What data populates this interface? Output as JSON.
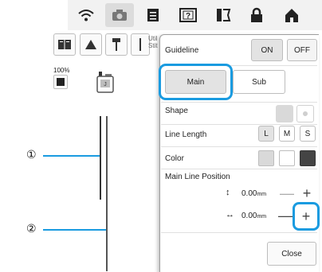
{
  "toolbar": {
    "icons": [
      "wifi-icon",
      "camera-icon",
      "document-icon",
      "help-icon",
      "thread-icon",
      "lock-icon",
      "home-icon"
    ]
  },
  "tools": {
    "util_label_1": "Util",
    "util_label_2": "Stit"
  },
  "zoom": "100%",
  "callouts": [
    "①",
    "②"
  ],
  "panel": {
    "guideline_label": "Guideline",
    "on_label": "ON",
    "off_label": "OFF",
    "tab_main": "Main",
    "tab_sub": "Sub",
    "shape_label": "Shape",
    "line_length_label": "Line Length",
    "length_options": [
      "L",
      "M",
      "S"
    ],
    "color_label": "Color",
    "position_label": "Main Line Position",
    "vertical_value": "0.00",
    "horizontal_value": "0.00",
    "unit": "mm",
    "minus": "—",
    "plus": "+",
    "close_label": "Close"
  },
  "colors": {
    "highlight": "#1a9be0",
    "swatch_light": "#d9d9d9",
    "swatch_white": "#ffffff",
    "swatch_dark": "#444444"
  }
}
